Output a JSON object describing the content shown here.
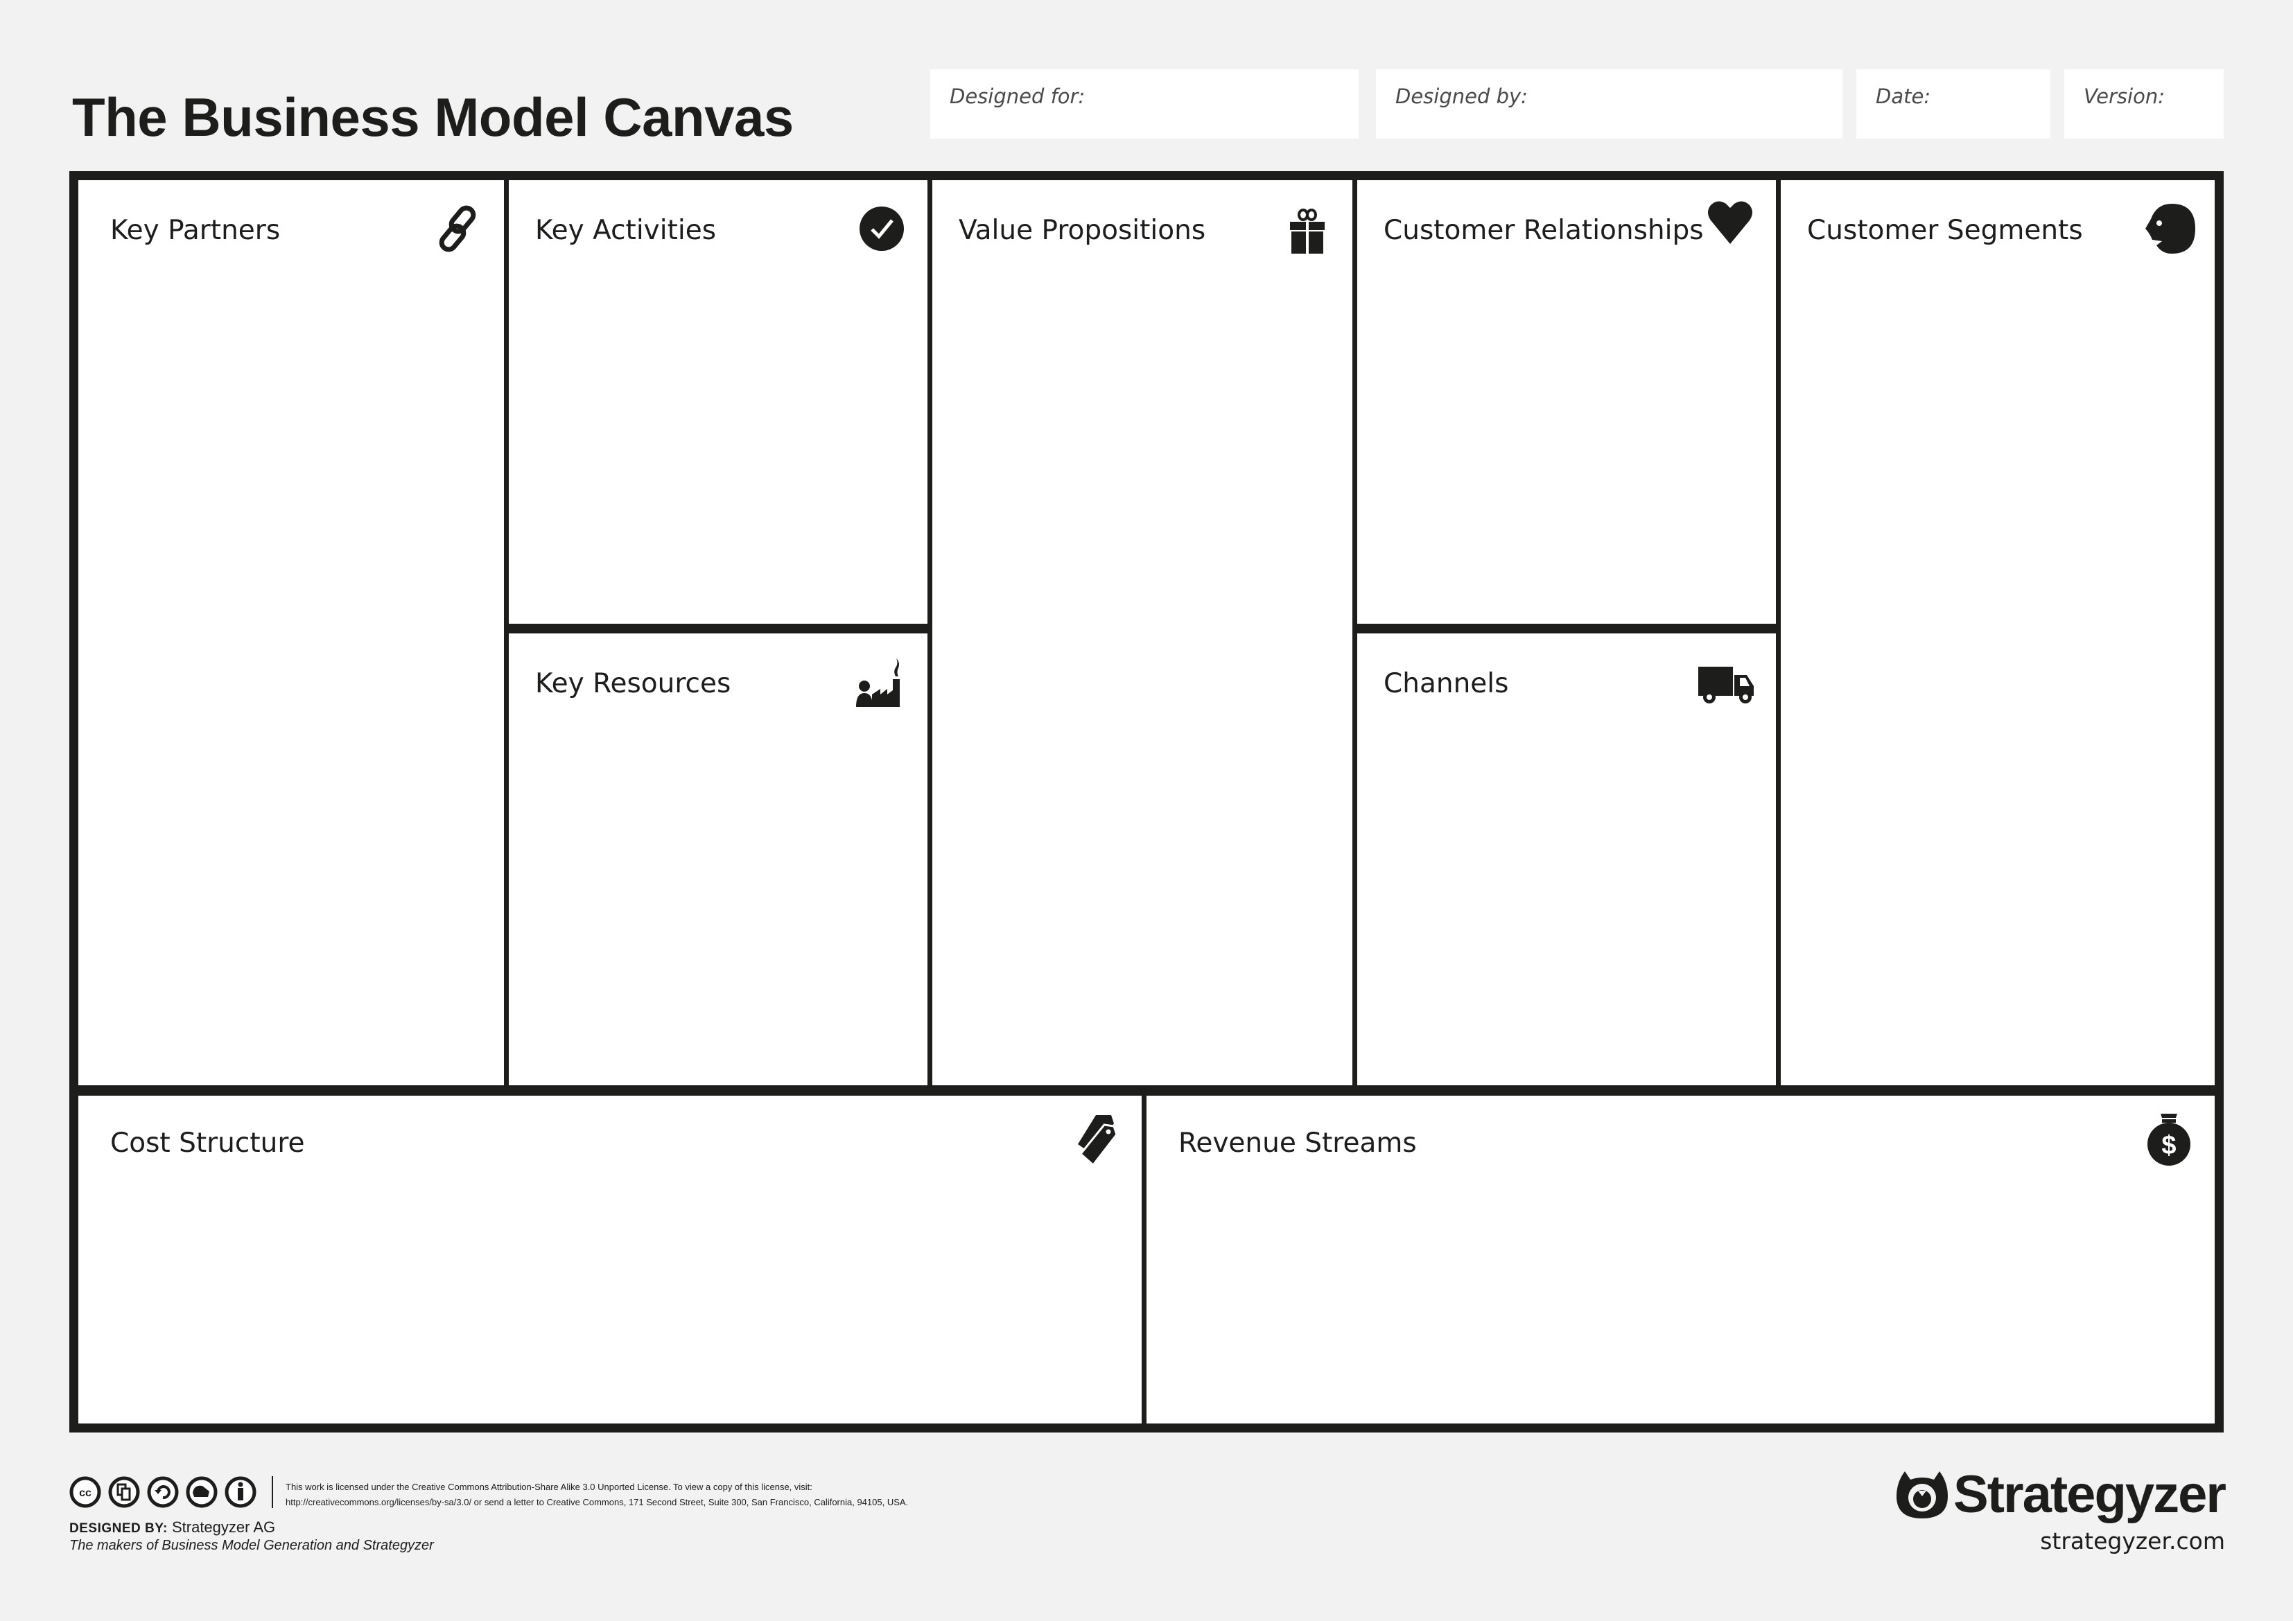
{
  "title": "The Business Model Canvas",
  "header_fields": {
    "designed_for": "Designed for:",
    "designed_by": "Designed by:",
    "date": "Date:",
    "version": "Version:"
  },
  "blocks": {
    "key_partners": {
      "label": "Key Partners",
      "icon": "link-icon"
    },
    "key_activities": {
      "label": "Key Activities",
      "icon": "checkmark-icon"
    },
    "key_resources": {
      "label": "Key Resources",
      "icon": "factory-worker-icon"
    },
    "value_propositions": {
      "label": "Value Propositions",
      "icon": "gift-icon"
    },
    "customer_relationships": {
      "label": "Customer Relationships",
      "icon": "heart-icon"
    },
    "channels": {
      "label": "Channels",
      "icon": "truck-icon"
    },
    "customer_segments": {
      "label": "Customer Segments",
      "icon": "face-profile-icon"
    },
    "cost_structure": {
      "label": "Cost Structure",
      "icon": "price-tag-icon"
    },
    "revenue_streams": {
      "label": "Revenue Streams",
      "icon": "money-bag-icon"
    }
  },
  "footer": {
    "license_icons": [
      "cc-icon",
      "share-icon",
      "remix-icon",
      "noncommercial-icon",
      "attribution-icon"
    ],
    "license_line1": "This work is licensed under the Creative Commons Attribution-Share Alike 3.0 Unported License. To view a copy of this license, visit:",
    "license_line2": "http://creativecommons.org/licenses/by-sa/3.0/ or send a letter to Creative Commons, 171 Second Street, Suite 300, San Francisco, California, 94105, USA.",
    "designed_by_label": "DESIGNED BY:",
    "designed_by_value": "Strategyzer AG",
    "makers_prefix": "The makers of ",
    "makers_bmg": "Business Model Generation",
    "makers_and": " and ",
    "makers_strategyzer": "Strategyzer",
    "brand": "Strategyzer",
    "website": "strategyzer.com"
  }
}
